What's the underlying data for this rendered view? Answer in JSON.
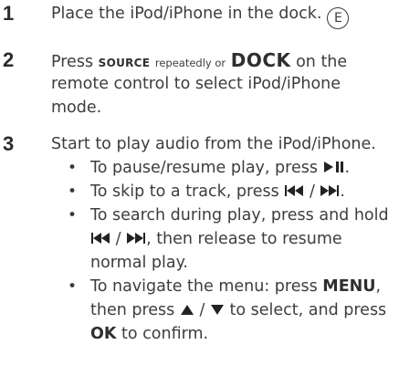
{
  "steps": [
    {
      "number": "1",
      "text": "Place the iPod/iPhone in the dock.",
      "badge": "E"
    },
    {
      "number": "2",
      "press": "Press",
      "source": "SOURCE",
      "repeatedly_or": "repeatedly or",
      "dock": "DOCK",
      "on_the": "on the",
      "line2": "remote control to select iPod/iPhone",
      "line3": "mode."
    },
    {
      "number": "3",
      "line1": "Start to play audio from the iPod/iPhone.",
      "bullets": [
        {
          "text": "To pause/resume play, press",
          "icon": "play-pause-icon",
          "end": "."
        },
        {
          "text": "To skip to a track, press",
          "icon_prev": "previous-track-icon",
          "sep": "/",
          "icon_next": "next-track-icon",
          "end": "."
        },
        {
          "line1": "To search during play, press and hold",
          "icon_prev": "previous-track-icon",
          "sep": "/",
          "icon_next": "next-track-icon",
          "line2_rest": ", then release to resume",
          "line3": "normal play."
        },
        {
          "line1_a": "To navigate the menu: press",
          "menu": "MENU",
          "line1_b": ",",
          "line2_a": "then press",
          "icon_up": "up-arrow-icon",
          "sep": "/",
          "icon_down": "down-arrow-icon",
          "line2_b": "to select, and press",
          "ok": "OK",
          "line3_b": "to confirm."
        }
      ]
    }
  ],
  "bullet_glyph": "•"
}
